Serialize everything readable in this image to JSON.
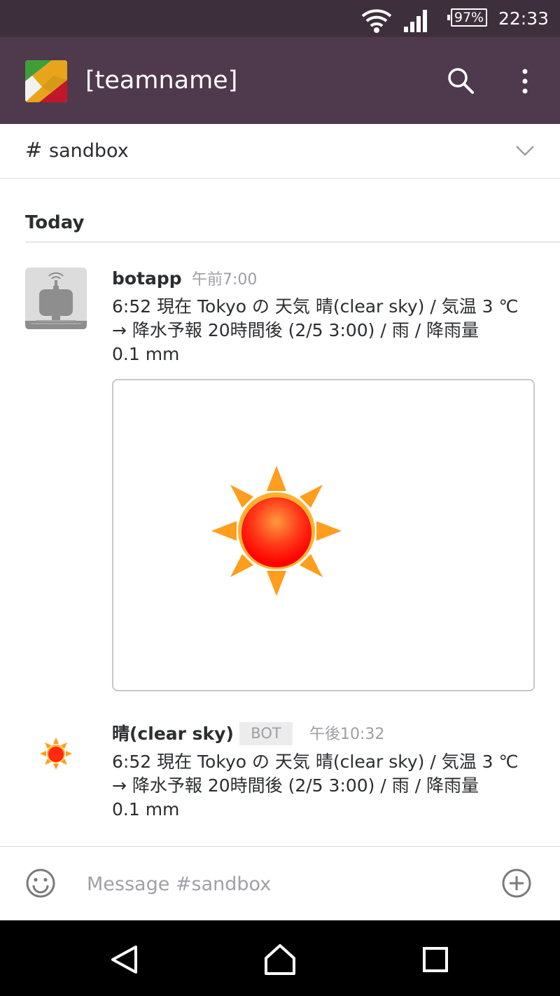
{
  "status_bar": {
    "battery": "97%",
    "time": "22:33",
    "icons": [
      "wifi-icon",
      "cell-signal-icon",
      "battery-icon"
    ]
  },
  "app_bar": {
    "team_name": "[teamname]",
    "icons": [
      "team-logo",
      "search-icon",
      "more-vert-icon"
    ],
    "background": "#4e3a4c"
  },
  "channel": {
    "hash": "#",
    "name": "sandbox",
    "icons": [
      "chevron-down-icon"
    ]
  },
  "day_divider": "Today",
  "messages": [
    {
      "sender": "botapp",
      "time": "午前7:00",
      "text": "6:52 現在 Tokyo の 天気 晴(clear sky) / 気温 3 ℃\n→ 降水予報 20時間後 (2/5 3:00) / 雨 / 降雨量\n0.1 mm",
      "avatar_icon": "robot-avatar-icon",
      "attachment_icon": "sun-icon"
    },
    {
      "sender": "晴(clear sky)",
      "badge": "BOT",
      "time": "午後10:32",
      "text": "6:52 現在 Tokyo の 天気 晴(clear sky) / 気温 3 ℃\n→ 降水予報 20時間後 (2/5 3:00) / 雨 / 降雨量\n0.1 mm",
      "avatar_icon": "sun-icon"
    }
  ],
  "composer": {
    "placeholder": "Message #sandbox",
    "icons": [
      "emoji-icon",
      "add-circle-icon"
    ]
  },
  "nav_bar": {
    "icons": [
      "back-icon",
      "home-icon",
      "recents-icon"
    ]
  }
}
